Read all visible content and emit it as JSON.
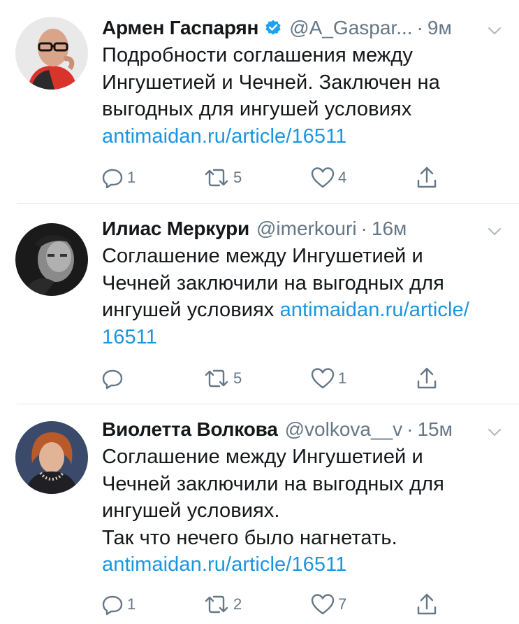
{
  "tweets": [
    {
      "name": "Армен Гаспарян",
      "verified": true,
      "handle": "@A_Gaspar...",
      "separator": "·",
      "time": "9м",
      "text_lines": [
        "Подробности соглашения между",
        "Ингушетией и Чечней. Заключен на",
        "выгодных для ингушей условиях"
      ],
      "link": "antimaidan.ru/article/16511",
      "counts": {
        "replies": "1",
        "retweets": "5",
        "likes": "4"
      }
    },
    {
      "name": "Илиас Меркури",
      "verified": false,
      "handle": "@imerkouri",
      "separator": "·",
      "time": "16м",
      "text_lines": [
        "Соглашение между Ингушетией и",
        "Чечней заключили на выгодных для"
      ],
      "text_inline_before_link": "ингушей условиях ",
      "link_part1": "antimaidan.ru/article/",
      "link_part2": "16511",
      "counts": {
        "replies": "",
        "retweets": "5",
        "likes": "1"
      }
    },
    {
      "name": "Виолетта Волкова",
      "verified": false,
      "handle": "@volkova__v",
      "separator": "·",
      "time": "15м",
      "text_lines": [
        "Соглашение между Ингушетией и",
        "Чечней заключили на выгодных для",
        "ингушей условиях.",
        "Так что нечего было нагнетать."
      ],
      "link": "antimaidan.ru/article/16511",
      "counts": {
        "replies": "1",
        "retweets": "2",
        "likes": "7"
      }
    }
  ],
  "colors": {
    "link": "#1b95e0",
    "secondary": "#657786",
    "verified": "#1da1f2",
    "divider": "#e1e8ed"
  },
  "icons": [
    "reply-icon",
    "retweet-icon",
    "like-icon",
    "share-icon",
    "chevron-down-icon",
    "verified-badge-icon"
  ]
}
